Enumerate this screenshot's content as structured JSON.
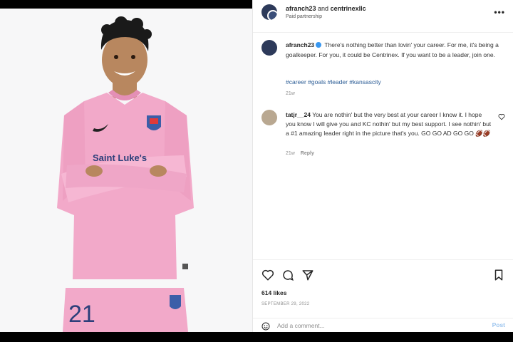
{
  "post": {
    "jersey_sponsor": "Saint Luke's",
    "jersey_number": "21"
  },
  "header": {
    "user1": "afranch23",
    "and": "and",
    "user2": "centrinexllc",
    "partnership": "Paid partnership",
    "more_icon": "more-horizontal-icon"
  },
  "caption": {
    "user": "afranch23",
    "text": "There's nothing better than lovin' your career. For me, it's being a goalkeeper. For you, it could be Centrinex. If you want to be a leader, join one.",
    "tags": "#career #goals #leader #kansascity",
    "time": "21w"
  },
  "comment": {
    "user": "tatjr__24",
    "text": "You are nothin' but the very best at your career I know it. I hope you know I will give you and KC nothin' but my best support. I see nothin' but a #1 amazing leader right in the picture that's you. GO GO AD GO GO 🏈🏈",
    "time": "21w",
    "reply": "Reply"
  },
  "actions": {
    "icons": [
      "heart-icon",
      "comment-icon",
      "share-icon",
      "bookmark-icon"
    ],
    "likes": "614 likes",
    "date": "SEPTEMBER 29, 2022"
  },
  "add_comment": {
    "placeholder": "Add a comment...",
    "post_label": "Post"
  },
  "colors": {
    "jersey_pink": "#f2a9c9",
    "link_blue": "#2c5d96",
    "verified_blue": "#3897f0",
    "post_button": "#9ec6ef"
  }
}
